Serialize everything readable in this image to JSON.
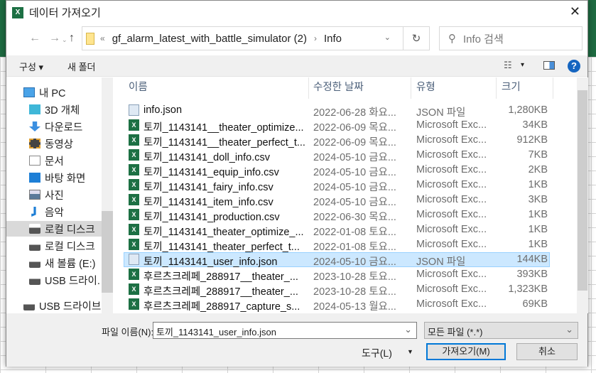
{
  "dialog": {
    "title": "데이터 가져오기",
    "close_icon": "close-icon"
  },
  "address": {
    "prefix": "«",
    "path": "gf_alarm_latest_with_battle_simulator (2)",
    "separator": "›",
    "current": "Info"
  },
  "search": {
    "placeholder": "Info 검색"
  },
  "toolbar": {
    "organize": "구성 ▾",
    "new_folder": "새 폴더",
    "view_toggle": "▾",
    "help": "?"
  },
  "tree": [
    {
      "label": "내 PC",
      "icon": "pc-icon"
    },
    {
      "label": "3D 개체",
      "icon": "cube-icon"
    },
    {
      "label": "다운로드",
      "icon": "download-icon"
    },
    {
      "label": "동영상",
      "icon": "video-icon"
    },
    {
      "label": "문서",
      "icon": "document-icon"
    },
    {
      "label": "바탕 화면",
      "icon": "desktop-icon"
    },
    {
      "label": "사진",
      "icon": "picture-icon"
    },
    {
      "label": "음악",
      "icon": "music-icon"
    },
    {
      "label": "로컬 디스크",
      "icon": "drive-icon",
      "selected": true
    },
    {
      "label": "로컬 디스크",
      "icon": "drive-icon"
    },
    {
      "label": "새 볼륨 (E:)",
      "icon": "drive-icon"
    },
    {
      "label": "USB 드라이.",
      "icon": "drive-icon"
    },
    {
      "label": "USB 드라이브",
      "icon": "drive-icon"
    }
  ],
  "columns": {
    "name": "이름",
    "date": "수정한 날짜",
    "type": "유형",
    "size": "크기"
  },
  "files": [
    {
      "name": "info.json",
      "date": "2022-06-28 화요...",
      "type": "JSON 파일",
      "size": "1,280KB",
      "kind": "json"
    },
    {
      "name": "토끼_1143141__theater_optimize...",
      "date": "2022-06-09 목요...",
      "type": "Microsoft Exc...",
      "size": "34KB",
      "kind": "xl"
    },
    {
      "name": "토끼_1143141__theater_perfect_t...",
      "date": "2022-06-09 목요...",
      "type": "Microsoft Exc...",
      "size": "912KB",
      "kind": "xl"
    },
    {
      "name": "토끼_1143141_doll_info.csv",
      "date": "2024-05-10 금요...",
      "type": "Microsoft Exc...",
      "size": "7KB",
      "kind": "xl"
    },
    {
      "name": "토끼_1143141_equip_info.csv",
      "date": "2024-05-10 금요...",
      "type": "Microsoft Exc...",
      "size": "2KB",
      "kind": "xl"
    },
    {
      "name": "토끼_1143141_fairy_info.csv",
      "date": "2024-05-10 금요...",
      "type": "Microsoft Exc...",
      "size": "1KB",
      "kind": "xl"
    },
    {
      "name": "토끼_1143141_item_info.csv",
      "date": "2024-05-10 금요...",
      "type": "Microsoft Exc...",
      "size": "3KB",
      "kind": "xl"
    },
    {
      "name": "토끼_1143141_production.csv",
      "date": "2022-06-30 목요...",
      "type": "Microsoft Exc...",
      "size": "1KB",
      "kind": "xl"
    },
    {
      "name": "토끼_1143141_theater_optimize_...",
      "date": "2022-01-08 토요...",
      "type": "Microsoft Exc...",
      "size": "1KB",
      "kind": "xl"
    },
    {
      "name": "토끼_1143141_theater_perfect_t...",
      "date": "2022-01-08 토요...",
      "type": "Microsoft Exc...",
      "size": "1KB",
      "kind": "xl"
    },
    {
      "name": "토끼_1143141_user_info.json",
      "date": "2024-05-10 금요...",
      "type": "JSON 파일",
      "size": "144KB",
      "kind": "json",
      "selected": true
    },
    {
      "name": "후르츠크레페_288917__theater_...",
      "date": "2023-10-28 토요...",
      "type": "Microsoft Exc...",
      "size": "393KB",
      "kind": "xl"
    },
    {
      "name": "후르츠크레페_288917__theater_...",
      "date": "2023-10-28 토요...",
      "type": "Microsoft Exc...",
      "size": "1,323KB",
      "kind": "xl"
    },
    {
      "name": "후르츠크레페_288917_capture_s...",
      "date": "2024-05-13 월요...",
      "type": "Microsoft Exc...",
      "size": "69KB",
      "kind": "xl"
    }
  ],
  "bottom": {
    "filename_label": "파일 이름(N):",
    "filename_value": "토끼_1143141_user_info.json",
    "filetype": "모든 파일 (*.*)",
    "tools": "도구(L)",
    "tools_arrow": "▼",
    "open": "가져오기(M)",
    "cancel": "취소"
  }
}
